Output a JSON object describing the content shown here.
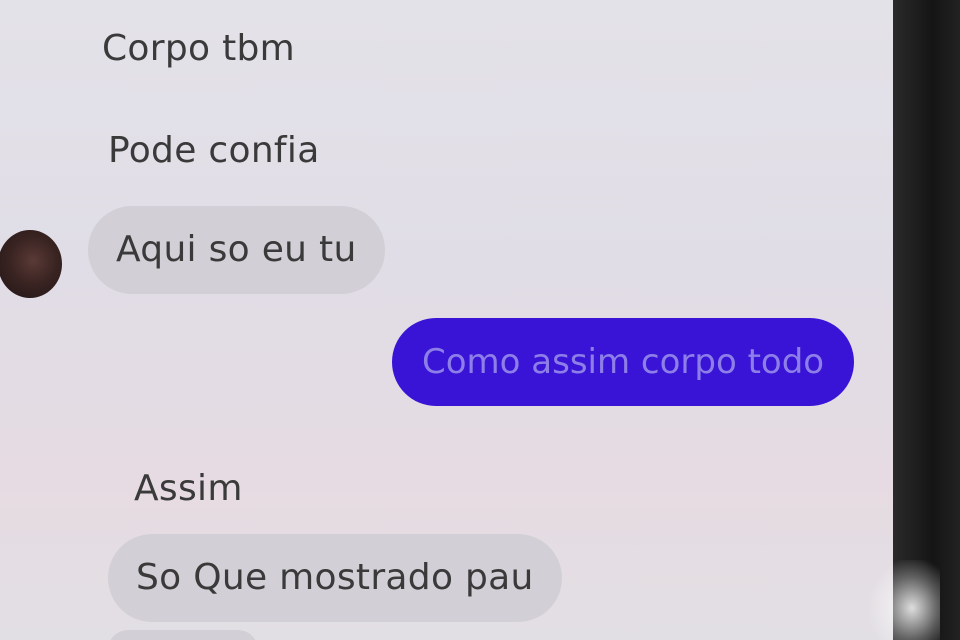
{
  "conversation": {
    "messages": [
      {
        "sender": "them",
        "text": "Corpo tbm"
      },
      {
        "sender": "them",
        "text": "Pode confia"
      },
      {
        "sender": "them",
        "text": "Aqui so eu tu"
      },
      {
        "sender": "me",
        "text": "Como assim corpo todo"
      },
      {
        "sender": "them",
        "text": "Assim"
      },
      {
        "sender": "them",
        "text": "So Que mostrado pau"
      }
    ]
  },
  "colors": {
    "outgoing_bubble": "#3a14d6",
    "incoming_bubble": "#d2d0d6",
    "background": "#e2dfe6"
  }
}
